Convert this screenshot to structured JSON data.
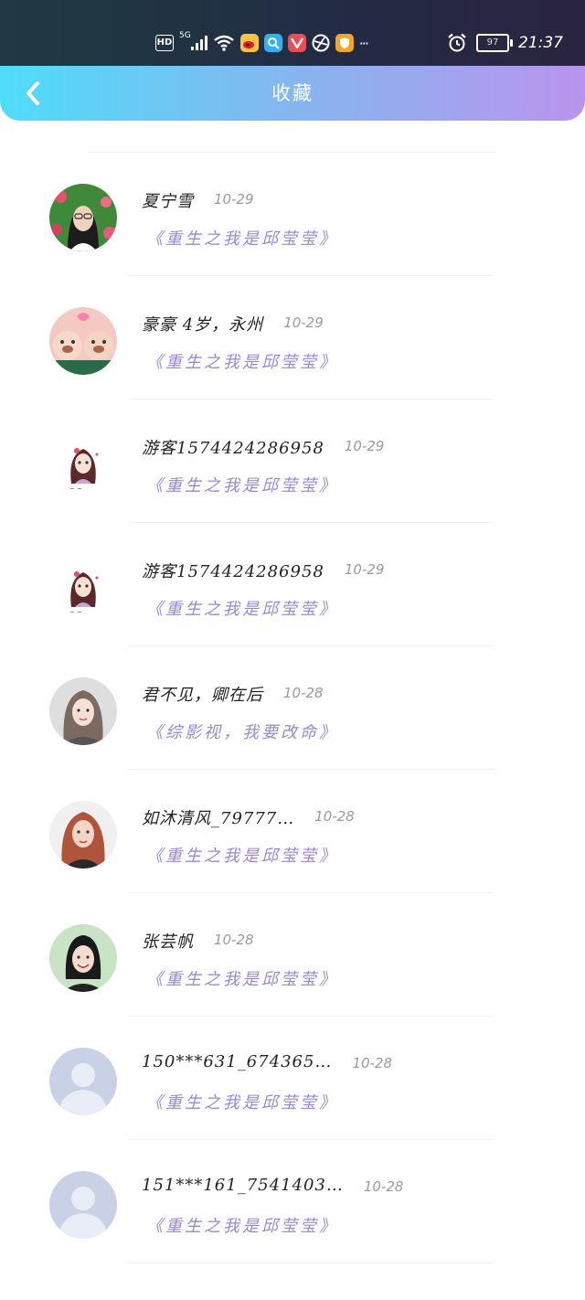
{
  "status_bar": {
    "hd": "HD",
    "network": "5G",
    "more": "···",
    "battery": "97",
    "time": "21:37"
  },
  "header": {
    "title": "收藏"
  },
  "items": [
    {
      "name": "夏宁雪",
      "date": "10-29",
      "book": "《重生之我是邱莹莹》",
      "avatar": "photo-woman-glasses"
    },
    {
      "name": "豪豪 4岁，永州",
      "date": "10-29",
      "book": "《重生之我是邱莹莹》",
      "avatar": "photo-children"
    },
    {
      "name": "游客1574424286958",
      "date": "10-29",
      "book": "《重生之我是邱莹莹》",
      "avatar": "anime-girl"
    },
    {
      "name": "游客1574424286958",
      "date": "10-29",
      "book": "《重生之我是邱莹莹》",
      "avatar": "anime-girl"
    },
    {
      "name": "君不见，卿在后",
      "date": "10-28",
      "book": "《综影视，我要改命》",
      "avatar": "photo-woman-light"
    },
    {
      "name": "如沐清风_79777…",
      "date": "10-28",
      "book": "《重生之我是邱莹莹》",
      "avatar": "photo-woman-red-hair"
    },
    {
      "name": "张芸帆",
      "date": "10-28",
      "book": "《重生之我是邱莹莹》",
      "avatar": "photo-woman-smile"
    },
    {
      "name": "150***631_674365…",
      "date": "10-28",
      "book": "《重生之我是邱莹莹》",
      "avatar": "default-avatar"
    },
    {
      "name": "151***161_7541403…",
      "date": "10-28",
      "book": "《重生之我是邱莹莹》",
      "avatar": "default-avatar"
    }
  ]
}
